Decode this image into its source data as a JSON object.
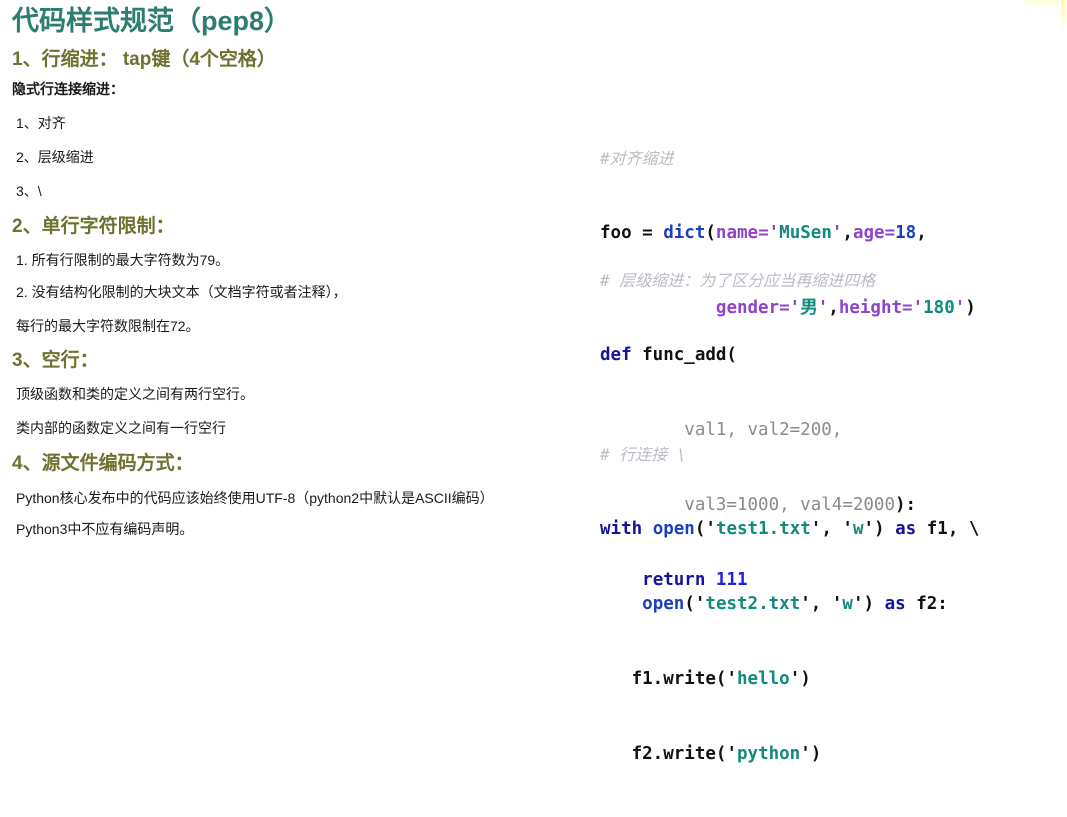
{
  "slide": {
    "title": "代码样式规范（pep8）",
    "title_color": "#2e7d71",
    "heading_color": "#6f7130",
    "body_color": "#1a1a1a",
    "background": "#ffffff"
  },
  "left": {
    "sections": [
      {
        "heading": "1、行缩进： tap键（4个空格）",
        "subheading": "隐式行连接缩进：",
        "items": [
          "1、对齐",
          "2、层级缩进",
          "3、\\"
        ]
      },
      {
        "heading": "2、单行字符限制：",
        "items": [
          "1. 所有行限制的最大字符数为79。",
          "2. 没有结构化限制的大块文本（文档字符或者注释），",
          "每行的最大字符数限制在72。"
        ]
      },
      {
        "heading": "3、空行：",
        "items": [
          "顶级函数和类的定义之间有两行空行。",
          "类内部的函数定义之间有一行空行"
        ]
      },
      {
        "heading": "4、源文件编码方式：",
        "items": [
          "Python核心发布中的代码应该始终使用UTF-8（python2中默认是ASCII编码）",
          "Python3中不应有编码声明。"
        ]
      }
    ]
  },
  "code": {
    "blocks": [
      {
        "name": "align-indent-example",
        "comment": "#对齐缩进",
        "lines": [
          "foo = dict(name='MuSen',age=18,",
          "           gender='男',height='180')"
        ],
        "tokens": {
          "foo": "foo",
          "assign": " = ",
          "dict": "dict",
          "open_paren": "(",
          "kw_name": "name",
          "eq": "=",
          "q": "'",
          "str_musen": "MuSen",
          "comma": ",",
          "kw_age": "age",
          "num_18": "18",
          "pad": "           ",
          "kw_gender": "gender",
          "str_nan": "男",
          "kw_height": "height",
          "str_180": "180",
          "close_paren": ")"
        }
      },
      {
        "name": "hanging-indent-example",
        "comment": "# 层级缩进：为了区分应当再缩进四格",
        "lines": [
          "def func_add(",
          "        val1, val2=200,",
          "        val3=1000, val4=2000):",
          "    return 111"
        ],
        "tokens": {
          "def": "def",
          "func_name": " func_add(",
          "params_line1": "        val1, val2=200,",
          "params_line2": "        val3=1000, val4=2000",
          "colon_close": "):",
          "indent": "    ",
          "return": "return",
          "ret_value": " 111"
        }
      },
      {
        "name": "line-continuation-example",
        "comment": "# 行连接 \\",
        "lines": [
          "with open('test1.txt', 'w') as f1, \\",
          "    open('test2.txt', 'w') as f2:",
          "  f1.write('hello')",
          "  f2.write('python')"
        ],
        "tokens": {
          "with": "with",
          "open": "open",
          "paren_open": "(",
          "q": "'",
          "file1": "test1.txt",
          "file2": "test2.txt",
          "comma_sp": ", ",
          "mode_w": "w",
          "paren_close": ")",
          "as": "as",
          "f1": " f1, ",
          "backslash": "\\",
          "f2": " f2:",
          "indent4": "    ",
          "indent6": "   ",
          "f1write": "f1.write",
          "f2write": "f2.write",
          "hello": "hello",
          "python": "python"
        }
      }
    ]
  },
  "syntax_colors": {
    "comment": "#b9bcc4",
    "keyword": "#141499",
    "builtin": "#1a3fbd",
    "param": "#8e44c9",
    "string": "#128a7d",
    "number": "#1a3fbd",
    "plain": "#111111",
    "gray_param": "#8b8b8b"
  }
}
